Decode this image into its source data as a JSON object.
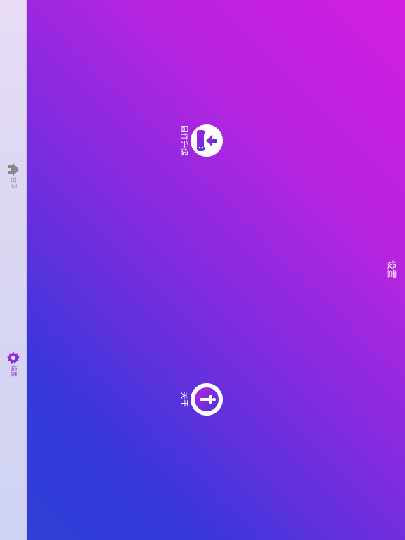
{
  "sidebar": {
    "items": [
      {
        "label": "首页",
        "icon": "home-icon",
        "active": false
      },
      {
        "label": "设置",
        "icon": "settings-gear-icon",
        "active": true
      }
    ]
  },
  "main": {
    "title": "设置",
    "actions": [
      {
        "label": "固件升级",
        "icon": "firmware-upgrade-icon"
      },
      {
        "label": "关于",
        "icon": "info-icon"
      }
    ]
  },
  "colors": {
    "accent": "#9b2ad8",
    "gradient_start": "#d21ee0",
    "gradient_end": "#3040d8",
    "inactive": "#8a8a8a"
  }
}
